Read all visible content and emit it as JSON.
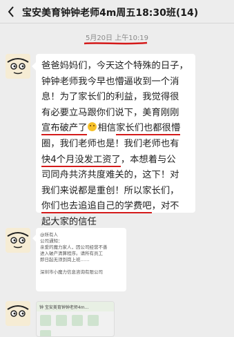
{
  "header": {
    "title": "宝安美育钟钟老师4m周五18:30班(14)"
  },
  "timestamp": "5月20日 上午10:19",
  "message": {
    "lines": [
      [
        {
          "t": "爸爸妈妈们，今天这个特殊的日子，"
        }
      ],
      [
        {
          "t": "钟钟老师我今早也懵逼收到一个消"
        }
      ],
      [
        {
          "t": "息！为了家长们的利益，我觉得很"
        }
      ],
      [
        {
          "t": "有必要立马跟你们说下，美育刚刚"
        }
      ],
      [
        {
          "t": "宣布破产了",
          "u": true
        },
        {
          "emoji": true
        },
        {
          "t": "相信"
        },
        {
          "t": "家长们也都很懵",
          "u": true
        }
      ],
      [
        {
          "t": "圈，我们老师也是！我们老师也有"
        }
      ],
      [
        {
          "t": "快4个月没发工资了",
          "u": true
        },
        {
          "t": "，本想着与公"
        }
      ],
      [
        {
          "t": "司同舟共济共度难关的，这下！对"
        }
      ],
      [
        {
          "t": "我们来说都是重创！所以家长们，"
        }
      ],
      [
        {
          "t": "你们也去追追自己的学费吧",
          "u": true
        },
        {
          "t": "，对不"
        }
      ],
      [
        {
          "t": "起大家的信任"
        }
      ]
    ]
  },
  "notice": {
    "lines": [
      "@所有人",
      "公司通知：",
      "亲爱的魔力家人，因公司经营不善",
      "进入破产清算程序。请所有员工",
      "即日起无须到岗上班……",
      "",
      "深圳市小魔力信息咨询有限公司"
    ]
  },
  "card": {
    "header_text": "钟 宝安美育钟钟老师4m..."
  }
}
